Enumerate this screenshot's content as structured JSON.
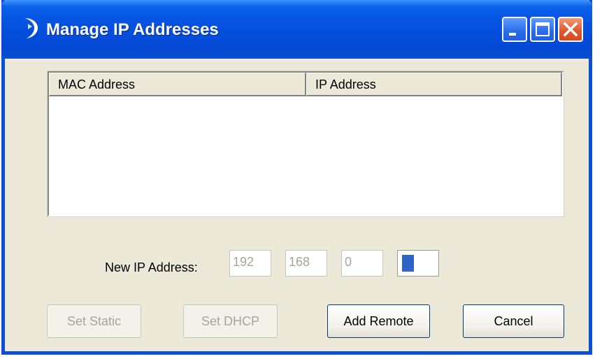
{
  "window": {
    "title": "Manage IP Addresses"
  },
  "titlebar_icons": [
    "app-icon",
    "minimize-icon",
    "maximize-icon",
    "close-icon"
  ],
  "list": {
    "columns": [
      {
        "label": "MAC Address"
      },
      {
        "label": "IP Address"
      }
    ],
    "rows": []
  },
  "ip_entry": {
    "label": "New IP Address:",
    "octets": [
      "192",
      "168",
      "0",
      ""
    ]
  },
  "buttons": {
    "set_static": "Set Static",
    "set_dhcp": "Set DHCP",
    "add_remote": "Add Remote",
    "cancel": "Cancel"
  },
  "colors": {
    "titlebar": "#0450e0",
    "close_button": "#e0582e",
    "dialog_face": "#ece9d8",
    "disabled_text": "#a7a49b"
  }
}
